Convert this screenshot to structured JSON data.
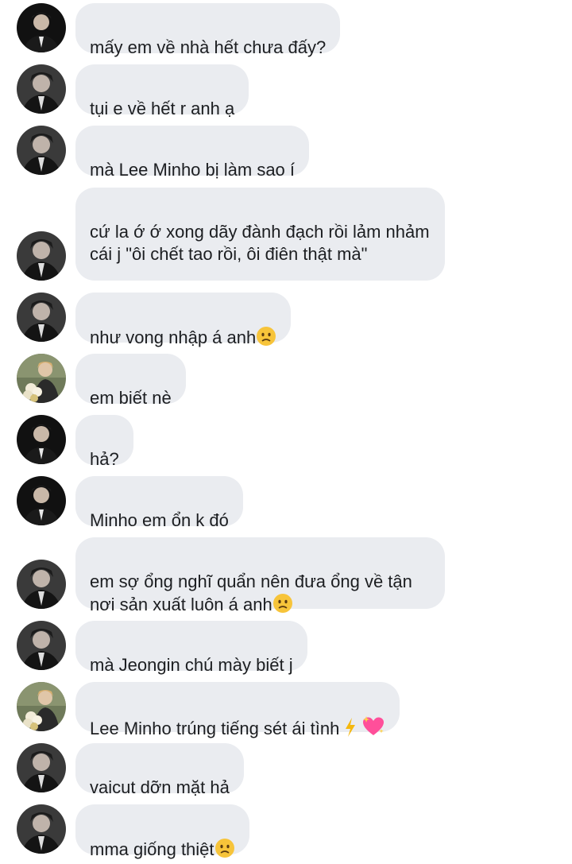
{
  "messages": [
    {
      "avatar": "boy",
      "text": "mấy em về nhà hết chưa đấy?",
      "emoji": ""
    },
    {
      "avatar": "boy2",
      "text": "tụi e về hết r anh ạ",
      "emoji": ""
    },
    {
      "avatar": "boy2",
      "text": "mà Lee Minho bị làm sao í",
      "emoji": ""
    },
    {
      "avatar": "boy2",
      "text": "cứ la ớ ớ xong dãy đành đạch rồi lảm nhảm cái j \"ôi chết tao rồi, ôi điên thật mà\"",
      "emoji": ""
    },
    {
      "avatar": "boy2",
      "text": "như vong nhập á anh",
      "emoji": "worried-face"
    },
    {
      "avatar": "flowers",
      "text": "em biết nè",
      "emoji": ""
    },
    {
      "avatar": "boy",
      "text": "hả?",
      "emoji": ""
    },
    {
      "avatar": "boy",
      "text": "Minho em ổn k đó",
      "emoji": ""
    },
    {
      "avatar": "boy2",
      "text": "em sợ ổng nghĩ quẩn nên đưa ổng về tận nơi sản xuất luôn á anh",
      "emoji": "worried-face"
    },
    {
      "avatar": "boy2",
      "text": "mà Jeongin chú mày biết j",
      "emoji": ""
    },
    {
      "avatar": "flowers",
      "text": "Lee Minho trúng tiếng sét ái tình",
      "emoji": "lightning-heart"
    },
    {
      "avatar": "boy2",
      "text": "vaicut dỡn mặt hả",
      "emoji": ""
    },
    {
      "avatar": "boy2",
      "text": "mma giống thiệt",
      "emoji": "worried-face"
    }
  ],
  "colors": {
    "bubble": "#eaecf0",
    "text": "#1c1e21",
    "background": "#ffffff"
  }
}
